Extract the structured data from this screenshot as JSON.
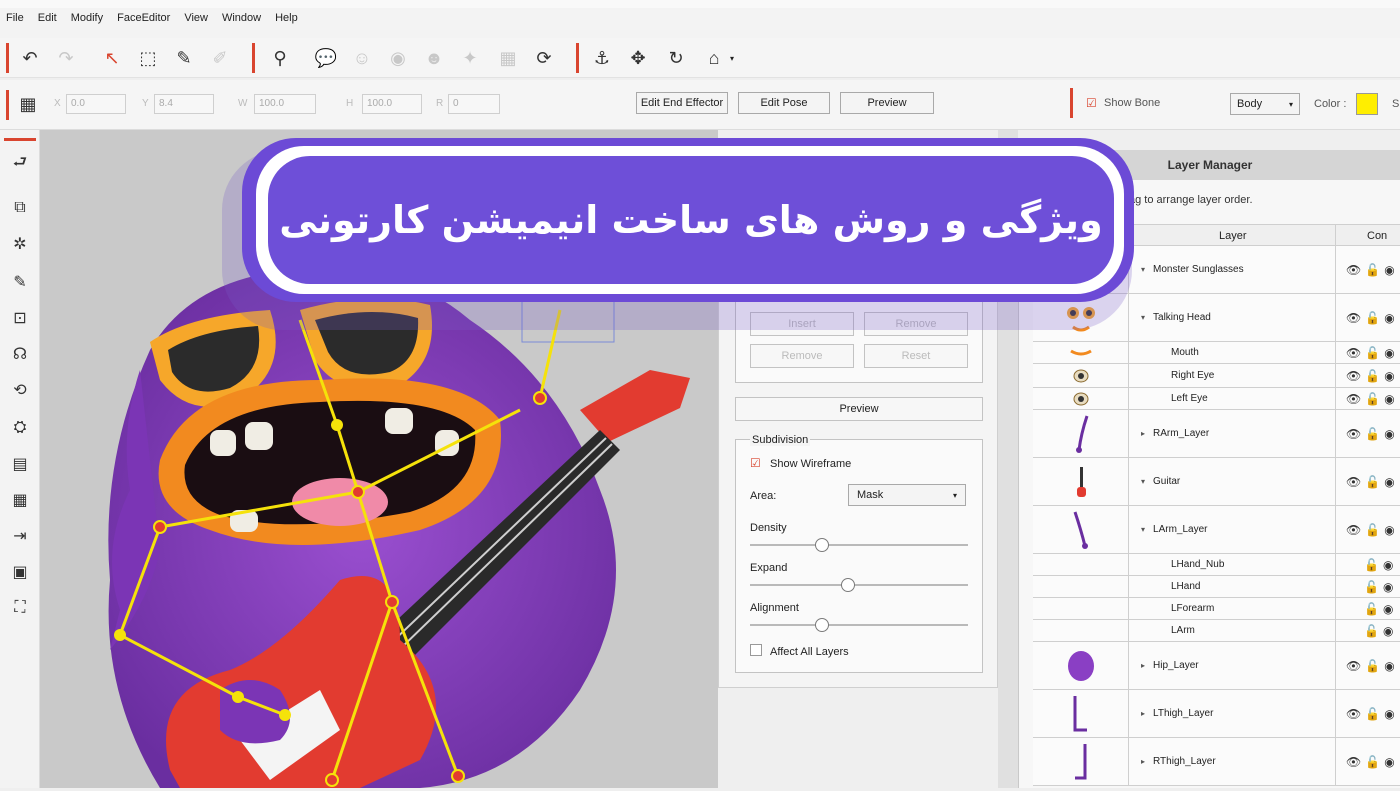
{
  "menu": [
    "File",
    "Edit",
    "Modify",
    "FaceEditor",
    "View",
    "Window",
    "Help"
  ],
  "toolbar2": {
    "x_label": "X",
    "x_value": "0.0",
    "y_label": "Y",
    "y_value": "8.4",
    "w_label": "W",
    "w_value": "100.0",
    "h_label": "H",
    "h_value": "100.0",
    "r_label": "R",
    "r_value": "0",
    "edit_end_effector": "Edit End Effector",
    "edit_pose": "Edit Pose",
    "preview": "Preview",
    "show_bone": "Show Bone",
    "body_select": "Body",
    "color_label": "Color :",
    "color_value": "#ffee00",
    "trailing_label": "S"
  },
  "banner": {
    "title": "ویژگی و روش های ساخت انیمیشن کارتونی"
  },
  "subdivision_panel": {
    "insert": "Insert",
    "remove_top": "Remove",
    "remove": "Remove",
    "reset": "Reset",
    "preview": "Preview",
    "section_title": "Subdivision",
    "show_wireframe": "Show Wireframe",
    "area_label": "Area:",
    "area_value": "Mask",
    "density_label": "Density",
    "expand_label": "Expand",
    "alignment_label": "Alignment",
    "affect_all": "Affect All  Layers",
    "density_level": 0.33,
    "expand_level": 0.45,
    "alignment_level": 0.33
  },
  "layer_manager": {
    "title": "Layer Manager",
    "hint": "ag to arrange layer order.",
    "col_layer": "Layer",
    "col_control": "Con",
    "layers": [
      {
        "name": "Monster Sunglasses",
        "arrow": "▾"
      },
      {
        "name": "Talking Head",
        "arrow": "▾"
      },
      {
        "name": "Mouth",
        "arrow": ""
      },
      {
        "name": "Right Eye",
        "arrow": ""
      },
      {
        "name": "Left Eye",
        "arrow": ""
      },
      {
        "name": "RArm_Layer",
        "arrow": "▸"
      },
      {
        "name": "Guitar",
        "arrow": "▾"
      },
      {
        "name": "LArm_Layer",
        "arrow": "▾"
      },
      {
        "name": "LHand_Nub",
        "arrow": ""
      },
      {
        "name": "LHand",
        "arrow": ""
      },
      {
        "name": "LForearm",
        "arrow": ""
      },
      {
        "name": "LArm",
        "arrow": ""
      },
      {
        "name": "Hip_Layer",
        "arrow": "▸"
      },
      {
        "name": "LThigh_Layer",
        "arrow": "▸"
      },
      {
        "name": "RThigh_Layer",
        "arrow": "▸"
      }
    ]
  }
}
